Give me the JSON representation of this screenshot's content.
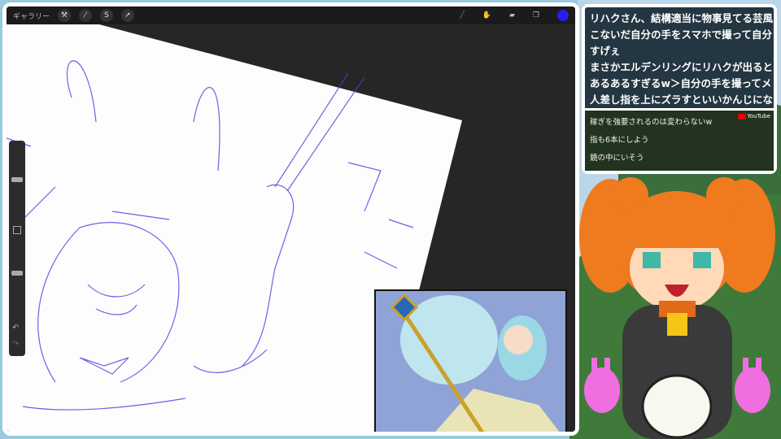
{
  "toolbar": {
    "gallery": "ギャラリー",
    "left_icons": [
      "wrench-icon",
      "magic-wand-icon",
      "selection-icon",
      "move-icon"
    ],
    "right_icons": [
      "brush-icon",
      "smudge-icon",
      "eraser-icon",
      "layers-icon"
    ],
    "brush_color": "#2a1cf0"
  },
  "chat": {
    "top_messages": [
      "リハクさん、結構適当に物事見てる芸風",
      "こないだ自分の手をスマホで撮って自分",
      "すげぇ",
      "まさかエルデンリングにリハクが出ると",
      "あるあるすぎるw＞自分の手を撮ってメ",
      "人差し指を上にズラすといいかんじにな"
    ],
    "source": "YouTube",
    "messages": [
      "稼ぎを強要されるのは変わらないw",
      "指も6本にしよう",
      "鏡の中にいそう"
    ]
  }
}
